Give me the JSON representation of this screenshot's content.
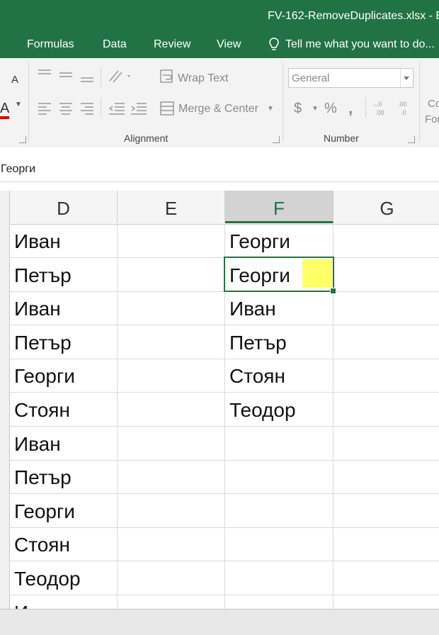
{
  "window": {
    "title": "FV-162-RemoveDuplicates.xlsx - E"
  },
  "ribbon_tabs": [
    "Formulas",
    "Data",
    "Review",
    "View"
  ],
  "tell_me": "Tell me what you want to do...",
  "ribbon": {
    "wrap_text": "Wrap Text",
    "merge_center": "Merge & Center",
    "number_format": "General",
    "alignment_group": "Alignment",
    "number_group": "Number",
    "cond_format_partial": "Co",
    "cond_format_partial2": "For",
    "font_color_label": "A",
    "font_size_label": "A",
    "currency": "$",
    "percent": "%",
    "comma": ",",
    "inc_decimal": "←.0 .00",
    "dec_decimal": ".00 →.0"
  },
  "formula_bar": {
    "content": "Георги"
  },
  "columns": [
    "D",
    "E",
    "F",
    "G"
  ],
  "selected_column": "F",
  "column_d": [
    "Иван",
    "Петър",
    "Иван",
    "Петър",
    "Георги",
    "Стоян",
    "Иван",
    "Петър",
    "Георги",
    "Стоян",
    "Теодор",
    "И"
  ],
  "column_f": [
    "Георги",
    "Георги",
    "Иван",
    "Петър",
    "Стоян",
    "Теодор"
  ],
  "colors": {
    "excel_green": "#217346",
    "highlight_yellow": "#ffff66"
  }
}
